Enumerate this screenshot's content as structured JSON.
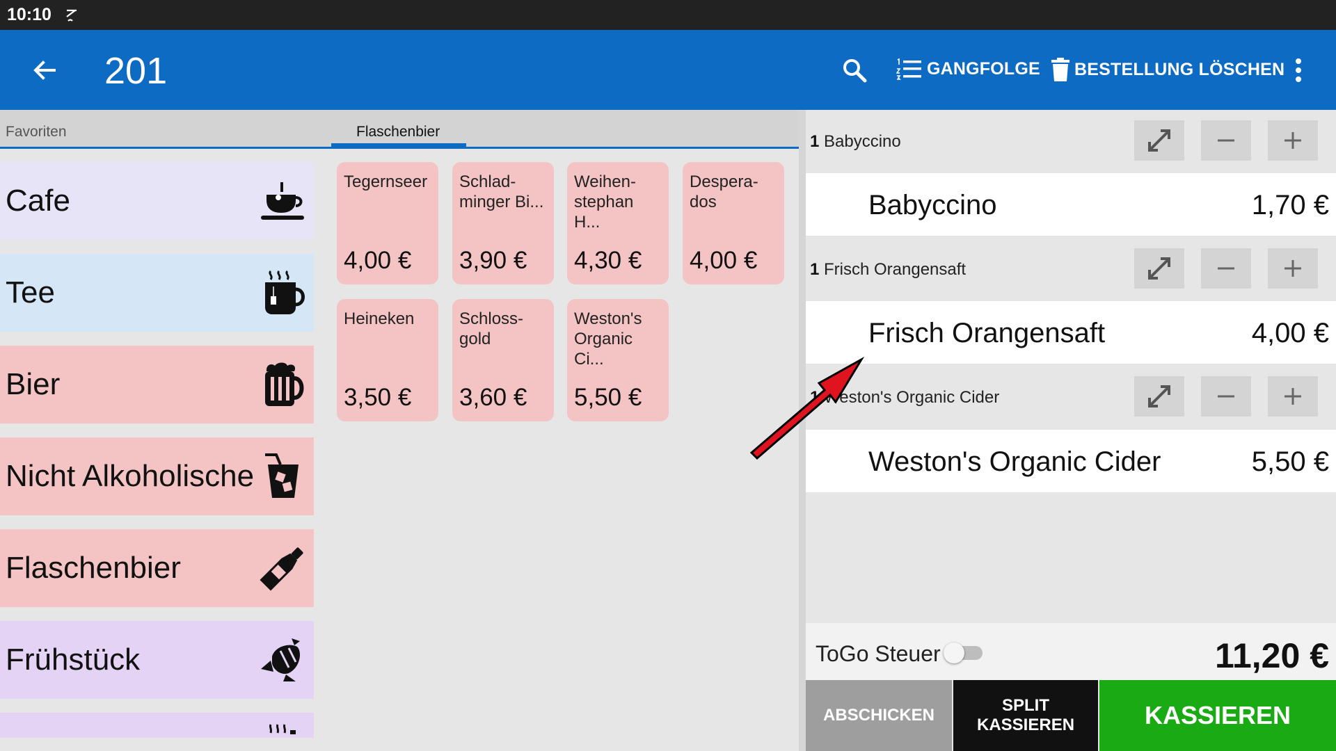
{
  "status_bar": {
    "time": "10:10",
    "icon": "cast-icon"
  },
  "app_bar": {
    "back_icon": "arrow-left-icon",
    "title": "201",
    "search_icon": "search-icon",
    "course_order": {
      "icon": "numbered-list-icon",
      "label": "GANGFOLGE"
    },
    "delete_order": {
      "icon": "trash-icon",
      "label": "BESTELLUNG LÖSCHEN"
    },
    "more_icon": "more-vert-icon",
    "color": "#0d6bc3"
  },
  "tabs": [
    {
      "label": "Favoriten",
      "active": false
    },
    {
      "label": "Flaschenbier",
      "active": true
    }
  ],
  "categories": [
    {
      "label": "Cafe",
      "icon": "coffee-cup-icon",
      "color": "#e8e4f7"
    },
    {
      "label": "Tee",
      "icon": "hot-mug-icon",
      "color": "#d5e6f6"
    },
    {
      "label": "Bier",
      "icon": "beer-mug-icon",
      "color": "#f4c3c4"
    },
    {
      "label": "Nicht Alkoholische",
      "icon": "soft-drink-icon",
      "color": "#f4c3c4"
    },
    {
      "label": "Flaschenbier",
      "icon": "bottle-icon",
      "color": "#f4c3c4"
    },
    {
      "label": "Frühstück",
      "icon": "croissant-icon",
      "color": "#e5d3f5"
    },
    {
      "label": "",
      "icon": "steam-icon",
      "color": "#e5d3f5"
    }
  ],
  "products": [
    {
      "name": "Tegernseer",
      "price": "4,00 €"
    },
    {
      "name": "Schlad-\nminger Bi...",
      "price": "3,90 €"
    },
    {
      "name": "Weihen-\nstephan H...",
      "price": "4,30 €"
    },
    {
      "name": "Despera-\ndos",
      "price": "4,00 €"
    },
    {
      "name": "Heineken",
      "price": "3,50 €"
    },
    {
      "name": "Schloss-\ngold",
      "price": "3,60 €"
    },
    {
      "name": "Weston's\nOrganic Ci...",
      "price": "5,50 €"
    }
  ],
  "order": {
    "items": [
      {
        "qty": "1",
        "name": "Babyccino",
        "line_name": "Babyccino",
        "price": "1,70 €"
      },
      {
        "qty": "1",
        "name": "Frisch Orangensaft",
        "line_name": "Frisch Orangensaft",
        "price": "4,00 €"
      },
      {
        "qty": "1",
        "name": "Weston's Organic Cider",
        "line_name": "Weston's Organic Cider",
        "price": "5,50 €"
      }
    ],
    "item_buttons": {
      "expand_icon": "expand-icon",
      "minus_icon": "minus-icon",
      "plus_icon": "plus-icon"
    },
    "togo_label": "ToGo Steuer",
    "togo_on": false,
    "total": "11,20 €",
    "buttons": {
      "send": "ABSCHICKEN",
      "split": "SPLIT KASSIEREN",
      "pay": "KASSIEREN"
    },
    "pay_color": "#1aaa14"
  },
  "annotation": {
    "icon": "red-arrow-icon",
    "color": "#e0141e"
  }
}
